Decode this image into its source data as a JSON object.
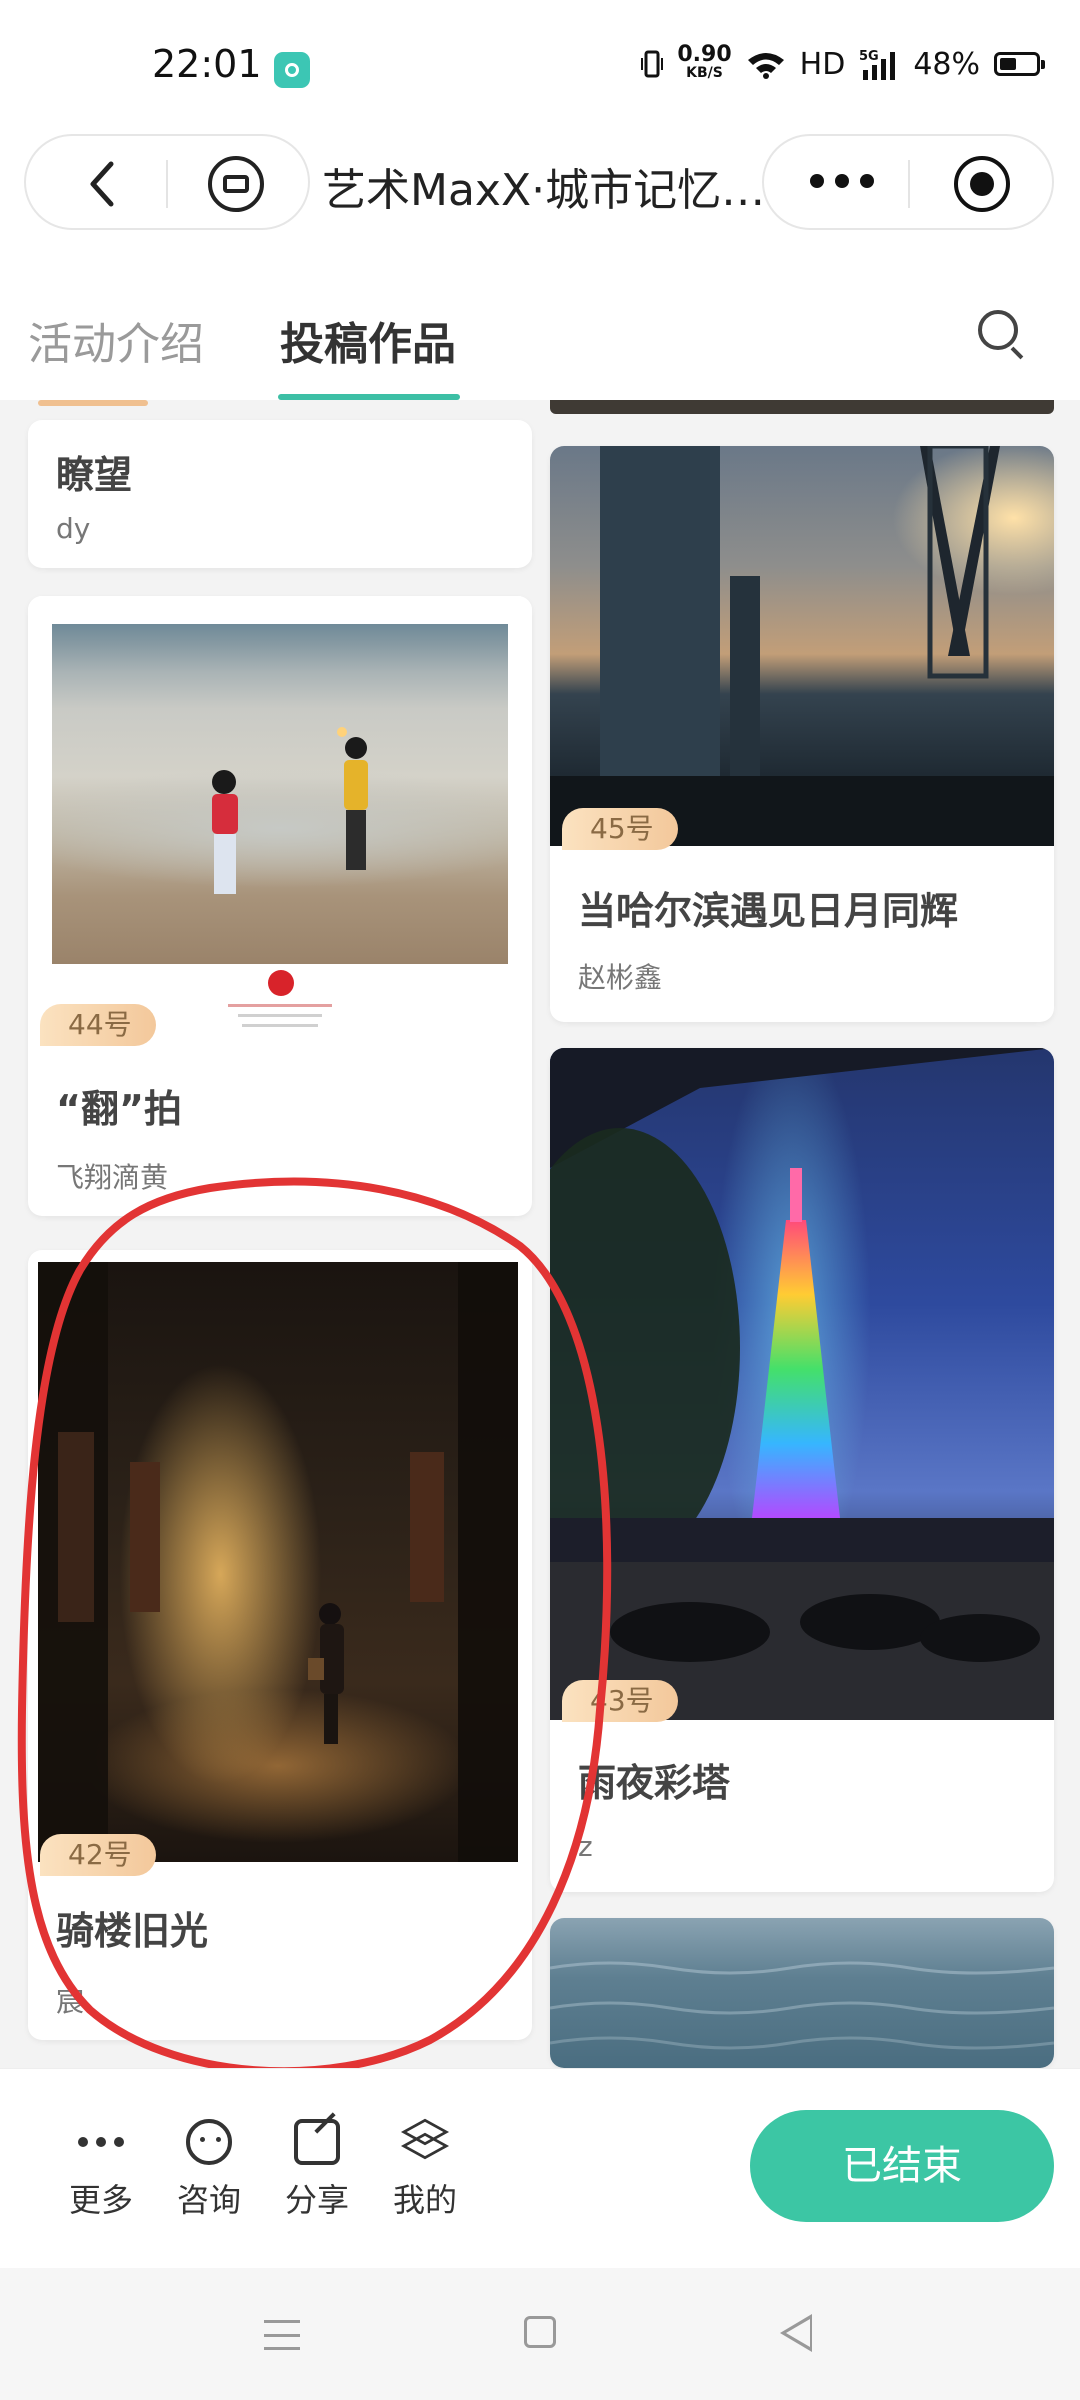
{
  "status_bar": {
    "time": "22:01",
    "speed_value": "0.90",
    "speed_unit": "KB/S",
    "hd": "HD",
    "network": "5G",
    "battery": "48%",
    "battery_level": 0.48
  },
  "nav": {
    "title": "艺术MaxX·城市记忆…"
  },
  "tabs": [
    {
      "label": "活动介绍",
      "active": false
    },
    {
      "label": "投稿作品",
      "active": true
    }
  ],
  "feed": {
    "left": [
      {
        "number": "",
        "title": "瞭望",
        "author": "dy"
      },
      {
        "number": "44号",
        "title": "“翻”拍",
        "author": "飞翔滴黄"
      },
      {
        "number": "42号",
        "title": "骑楼旧光",
        "author": "宸"
      }
    ],
    "right": [
      {
        "number": "45号",
        "title": "当哈尔滨遇见日月同辉",
        "author": "赵彬鑫"
      },
      {
        "number": "43号",
        "title": "雨夜彩塔",
        "author": "z"
      },
      {
        "number": "",
        "title": "",
        "author": ""
      }
    ]
  },
  "bottom_bar": {
    "items": [
      {
        "label": "更多",
        "icon": "more-icon"
      },
      {
        "label": "咨询",
        "icon": "chat-icon"
      },
      {
        "label": "分享",
        "icon": "share-icon"
      },
      {
        "label": "我的",
        "icon": "layers-icon"
      }
    ],
    "status_button": "已结束",
    "accent_color": "#3cc6a4"
  },
  "colors": {
    "tab_accent": "#3cbfa5",
    "annotation": "#e23434"
  }
}
